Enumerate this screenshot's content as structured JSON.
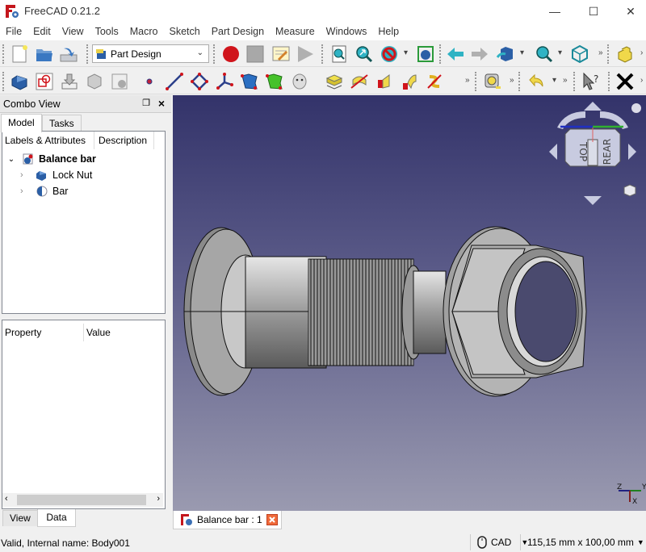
{
  "window": {
    "title": "FreeCAD 0.21.2",
    "controls": {
      "minimize": "—",
      "maximize": "☐",
      "close": "✕"
    }
  },
  "menu": {
    "items": [
      "File",
      "Edit",
      "View",
      "Tools",
      "Macro",
      "Sketch",
      "Part Design",
      "Measure",
      "Windows",
      "Help"
    ]
  },
  "toolbar": {
    "workbench": "Part Design",
    "row1_icons": [
      "new-file-icon",
      "open-file-icon",
      "save-icon",
      "workbench-selector",
      "macro-record-icon",
      "macro-stop-icon",
      "macro-edit-icon",
      "macro-run-icon",
      "fit-all-icon",
      "fit-selection-icon",
      "draw-style-icon",
      "bounding-box-icon",
      "back-icon",
      "forward-icon",
      "std-views-icon",
      "zoom-icon",
      "isometric-icon",
      "part-icon"
    ],
    "row2_icons": [
      "body-icon",
      "sketch-icon",
      "shape-binder-icon",
      "subshape-binder-icon",
      "clone-icon",
      "point-icon",
      "line-icon",
      "plane-icon",
      "local-cs-icon",
      "pad-icon",
      "pocket-icon",
      "sheep-icon",
      "pad-feature-icon",
      "revolution-icon",
      "additive-loft-icon",
      "additive-pipe-icon",
      "helix-icon",
      "measure-icon",
      "undo-icon",
      "whats-this-icon",
      "close-icon"
    ],
    "overflow": "»"
  },
  "combo_view": {
    "title": "Combo View",
    "tabs": [
      "Model",
      "Tasks"
    ],
    "tree_headers": [
      "Labels & Attributes",
      "Description"
    ],
    "tree": [
      {
        "label": "Balance bar",
        "expanded": true,
        "bold": true,
        "icon": "document-icon"
      },
      {
        "label": "Lock Nut",
        "expanded": false,
        "icon": "body-icon"
      },
      {
        "label": "Bar",
        "expanded": false,
        "icon": "body-icon"
      }
    ],
    "property_headers": [
      "Property",
      "Value"
    ],
    "bottom_tabs": [
      "View",
      "Data"
    ]
  },
  "navcube": {
    "faces": [
      "TOP",
      "REAR"
    ]
  },
  "axis": {
    "labels": [
      "Z",
      "Y",
      "X"
    ]
  },
  "doc_tab": {
    "label": "Balance bar : 1"
  },
  "status": {
    "message": "Valid, Internal name: Body001",
    "nav_style": "CAD",
    "dimensions": "115,15 mm x 100,00 mm"
  }
}
